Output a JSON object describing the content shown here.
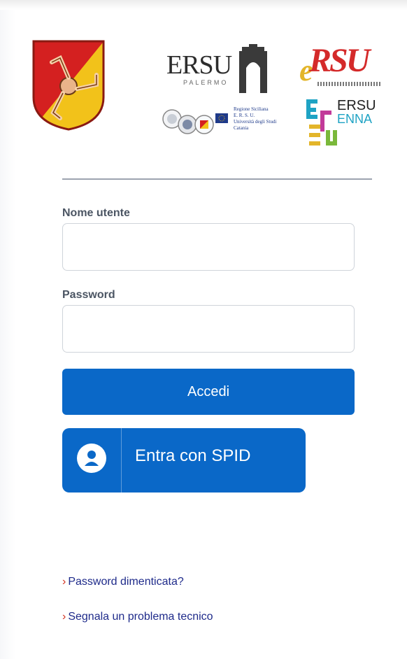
{
  "logos": {
    "ersu_palermo": {
      "text": "ERSU",
      "sub": "PALERMO"
    },
    "ersu_messina": {
      "text": "RSU",
      "prefix": "e"
    },
    "ersu_catania": {
      "lines": [
        "Regione Siciliana",
        "E. R. S. U.",
        "Università degli Studi",
        "Catania"
      ]
    },
    "ersu_enna": {
      "line1": "ERSU",
      "line2": "ENNA"
    }
  },
  "form": {
    "username_label": "Nome utente",
    "username_value": "",
    "password_label": "Password",
    "password_value": "",
    "login_button": "Accedi",
    "spid_button": "Entra con SPID"
  },
  "links": {
    "forgot_password": "Password dimenticata?",
    "report_problem": "Segnala un problema tecnico",
    "chevron": "›"
  },
  "colors": {
    "primary": "#0a68c8",
    "link": "#1e2a8a",
    "chevron": "#d2301e"
  }
}
